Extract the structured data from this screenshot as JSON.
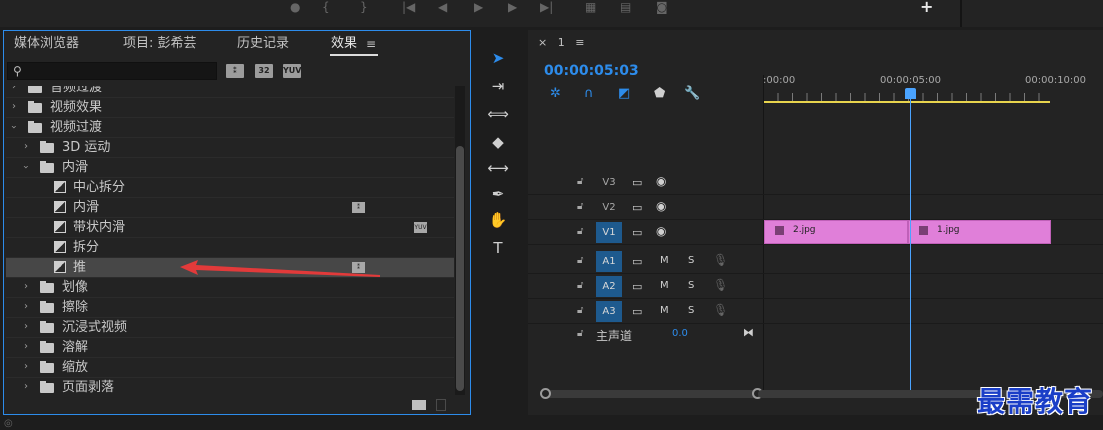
{
  "colors": {
    "accent": "#2d8ceb",
    "clip": "#e07fd9",
    "selected_row": "#474747",
    "playhead": "#4aa3ff"
  },
  "effects_panel": {
    "tabs": [
      {
        "label": "媒体浏览器"
      },
      {
        "label": "项目: 彭希芸"
      },
      {
        "label": "历史记录"
      },
      {
        "label": "效果"
      }
    ],
    "menu_icon": "menu-icon",
    "search": {
      "value": "",
      "placeholder": ""
    },
    "filter_buttons": [
      "accelerated-effects-icon",
      "32bit-icon",
      "yuv-icon"
    ],
    "tree": [
      {
        "label": "音频过渡",
        "level": 0,
        "expanded": false,
        "type": "folder"
      },
      {
        "label": "视频效果",
        "level": 0,
        "expanded": false,
        "type": "folder"
      },
      {
        "label": "视频过渡",
        "level": 0,
        "expanded": true,
        "type": "folder"
      },
      {
        "label": "3D 运动",
        "level": 1,
        "expanded": false,
        "type": "folder"
      },
      {
        "label": "内滑",
        "level": 1,
        "expanded": true,
        "type": "folder"
      },
      {
        "label": "中心拆分",
        "level": 2,
        "type": "effect"
      },
      {
        "label": "内滑",
        "level": 2,
        "type": "effect",
        "badge": "accelerated"
      },
      {
        "label": "带状内滑",
        "level": 2,
        "type": "effect",
        "badge": "yuv"
      },
      {
        "label": "拆分",
        "level": 2,
        "type": "effect"
      },
      {
        "label": "推",
        "level": 2,
        "type": "effect",
        "badge": "accelerated",
        "selected": true
      },
      {
        "label": "划像",
        "level": 1,
        "expanded": false,
        "type": "folder"
      },
      {
        "label": "擦除",
        "level": 1,
        "expanded": false,
        "type": "folder"
      },
      {
        "label": "沉浸式视频",
        "level": 1,
        "expanded": false,
        "type": "folder"
      },
      {
        "label": "溶解",
        "level": 1,
        "expanded": false,
        "type": "folder"
      },
      {
        "label": "缩放",
        "level": 1,
        "expanded": false,
        "type": "folder"
      },
      {
        "label": "页面剥落",
        "level": 1,
        "expanded": false,
        "type": "folder"
      }
    ]
  },
  "tools": [
    "selection-tool-icon",
    "track-select-tool-icon",
    "ripple-edit-tool-icon",
    "razor-tool-icon",
    "slip-tool-icon",
    "pen-tool-icon",
    "hand-tool-icon",
    "type-tool-icon"
  ],
  "timeline": {
    "sequence_name": "1",
    "timecode": "00:00:05:03",
    "ruler_labels": [
      ":00:00",
      "00:00:05:00",
      "00:00:10:00"
    ],
    "video_tracks": [
      {
        "name": "V3",
        "target": false
      },
      {
        "name": "V2",
        "target": false
      },
      {
        "name": "V1",
        "target": true
      }
    ],
    "audio_tracks": [
      {
        "name": "A1",
        "target": true,
        "m": "M",
        "s": "S"
      },
      {
        "name": "A2",
        "target": true,
        "m": "M",
        "s": "S"
      },
      {
        "name": "A3",
        "target": true,
        "m": "M",
        "s": "S"
      }
    ],
    "master": {
      "label": "主声道",
      "value": "0.0"
    },
    "clips": [
      {
        "name": "2.jpg"
      },
      {
        "name": "1.jpg"
      }
    ]
  },
  "watermark": "最需教育"
}
